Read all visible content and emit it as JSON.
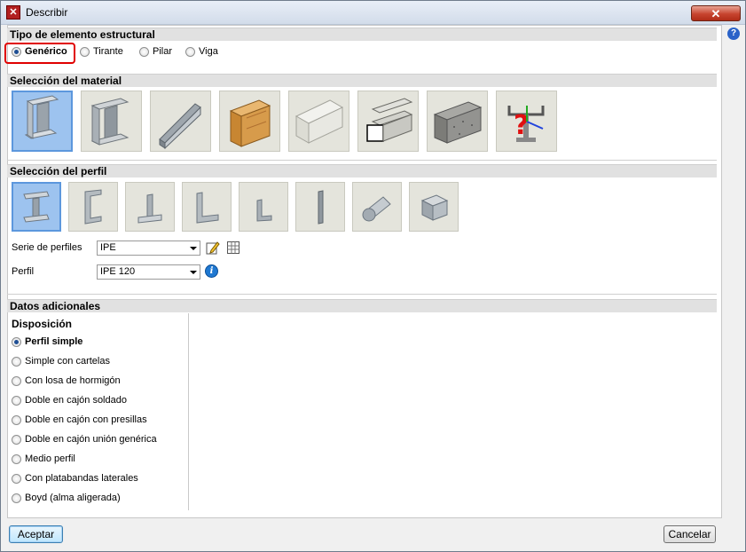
{
  "window": {
    "title": "Describir",
    "close_glyph": "✕",
    "help_glyph": "?"
  },
  "structural_type": {
    "header": "Tipo de elemento estructural",
    "options": [
      {
        "label": "Genérico",
        "checked": true
      },
      {
        "label": "Tirante",
        "checked": false
      },
      {
        "label": "Pilar",
        "checked": false
      },
      {
        "label": "Viga",
        "checked": false
      }
    ]
  },
  "material": {
    "header": "Selección del material",
    "tiles": [
      {
        "icon": "hot-rolled-steel-icon",
        "selected": true
      },
      {
        "icon": "welded-steel-icon",
        "selected": false
      },
      {
        "icon": "cold-formed-steel-icon",
        "selected": false
      },
      {
        "icon": "wood-icon",
        "selected": false
      },
      {
        "icon": "aluminium-icon",
        "selected": false
      },
      {
        "icon": "aluminium-extrusion-icon",
        "selected": false
      },
      {
        "icon": "concrete-icon",
        "selected": false
      },
      {
        "icon": "generic-material-icon",
        "selected": false
      }
    ]
  },
  "profile": {
    "header": "Selección del perfil",
    "tiles": [
      {
        "icon": "i-beam-profile-icon",
        "selected": true
      },
      {
        "icon": "channel-profile-icon",
        "selected": false
      },
      {
        "icon": "tee-profile-icon",
        "selected": false
      },
      {
        "icon": "angle-profile-icon",
        "selected": false
      },
      {
        "icon": "small-angle-profile-icon",
        "selected": false
      },
      {
        "icon": "plate-profile-icon",
        "selected": false
      },
      {
        "icon": "round-bar-profile-icon",
        "selected": false
      },
      {
        "icon": "square-bar-profile-icon",
        "selected": false
      }
    ],
    "series_label": "Serie de perfiles",
    "series_value": "IPE",
    "profile_label": "Perfil",
    "profile_value": "IPE 120",
    "info_glyph": "i"
  },
  "additional": {
    "header": "Datos adicionales",
    "disposition_title": "Disposición",
    "options": [
      {
        "label": "Perfil simple",
        "checked": true
      },
      {
        "label": "Simple con cartelas",
        "checked": false
      },
      {
        "label": "Con losa de hormigón",
        "checked": false
      },
      {
        "label": "Doble en cajón soldado",
        "checked": false
      },
      {
        "label": "Doble en cajón con presillas",
        "checked": false
      },
      {
        "label": "Doble en cajón unión genérica",
        "checked": false
      },
      {
        "label": "Medio perfil",
        "checked": false
      },
      {
        "label": "Con platabandas laterales",
        "checked": false
      },
      {
        "label": "Boyd (alma aligerada)",
        "checked": false
      }
    ]
  },
  "footer": {
    "accept_label": "Aceptar",
    "cancel_label": "Cancelar"
  }
}
